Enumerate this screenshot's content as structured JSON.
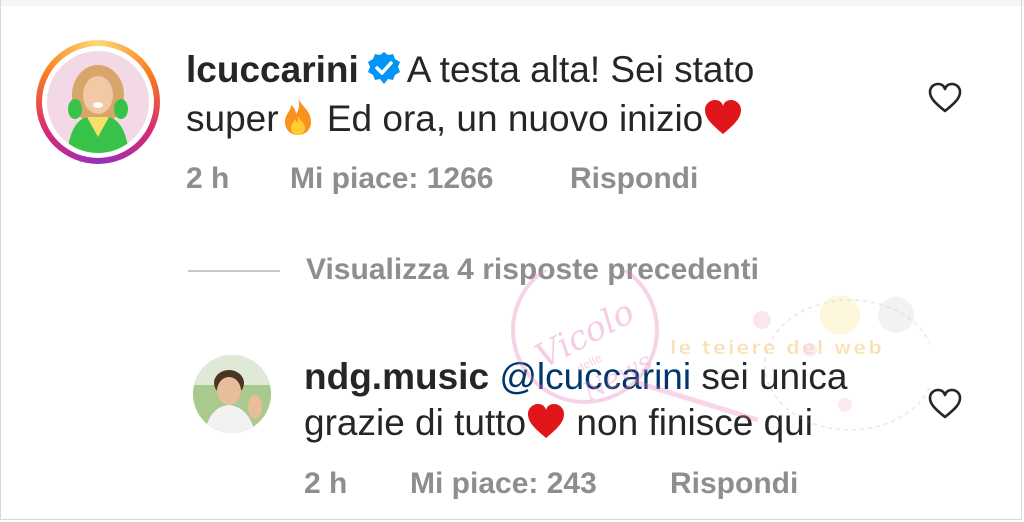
{
  "comments": [
    {
      "username": "lcuccarini",
      "text_line1": "A testa alta! Sei stato",
      "text_line2a": "super",
      "text_line2b": "Ed ora, un nuovo inizio",
      "time": "2 h",
      "likes": "Mi piace: 1266",
      "reply": "Rispondi"
    },
    {
      "username": "ndg.music",
      "mention": "@lcuccarini",
      "text_line1": "sei unica",
      "text_line2a": "grazie di tutto",
      "text_line2b": "non finisce qui",
      "time": "2 h",
      "likes": "Mi piace: 243",
      "reply": "Rispondi"
    }
  ],
  "view_previous_replies": "Visualizza 4 risposte precedenti",
  "watermark": {
    "script_text": "Vicolo",
    "small_text": "delle",
    "bottom_text": "News",
    "banner_text": "le teiere del web"
  },
  "colors": {
    "text": "#262626",
    "secondary": "#8e8e8e",
    "mention": "#00376b",
    "verified": "#0095f6",
    "heart_emoji": "#e0161b"
  },
  "icons": [
    "verified-badge-icon",
    "fire-emoji-icon",
    "red-heart-emoji-icon",
    "heart-outline-icon"
  ]
}
